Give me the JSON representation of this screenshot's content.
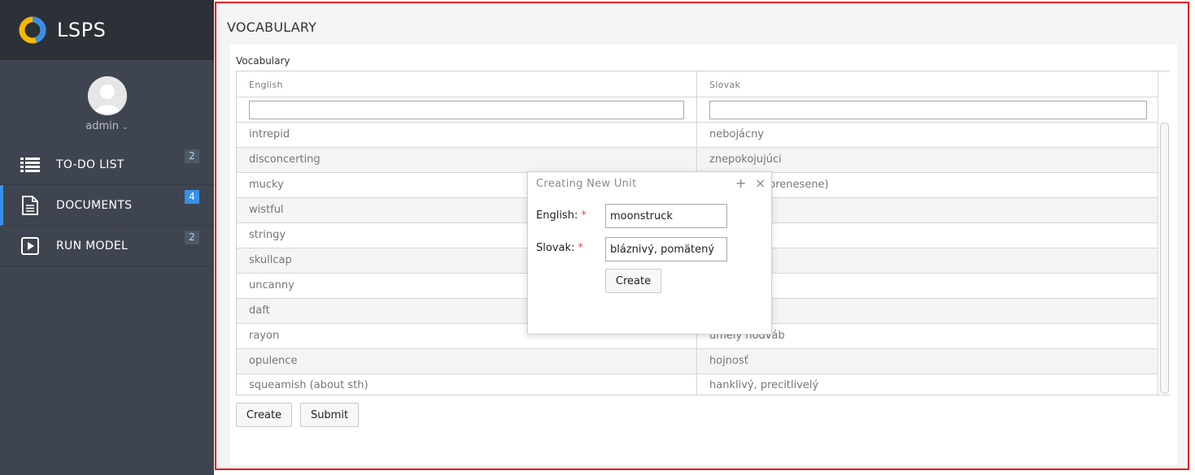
{
  "app": {
    "name": "LSPS"
  },
  "user": {
    "name": "admin"
  },
  "nav": [
    {
      "label": "TO-DO LIST",
      "icon": "list-icon",
      "badge": "2"
    },
    {
      "label": "DOCUMENTS",
      "icon": "document-icon",
      "badge": "4",
      "active": true
    },
    {
      "label": "RUN MODEL",
      "icon": "play-icon",
      "badge": "2"
    }
  ],
  "page": {
    "title": "VOCABULARY"
  },
  "panel": {
    "title": "Vocabulary"
  },
  "grid": {
    "columns": [
      "English",
      "Slovak"
    ],
    "filters": [
      "",
      ""
    ],
    "rows": [
      [
        "intrepid",
        "nebojácny"
      ],
      [
        "disconcerting",
        "znepokojujúci"
      ],
      [
        "mucky",
        "prenesene)"
      ],
      [
        "wistful",
        ""
      ],
      [
        "stringy",
        ""
      ],
      [
        "skullcap",
        ""
      ],
      [
        "uncanny",
        ""
      ],
      [
        "daft",
        ""
      ],
      [
        "rayon",
        "umelý hodváb"
      ],
      [
        "opulence",
        "hojnosť"
      ],
      [
        "squeamish (about sth)",
        "hanklivý, precitlivelý"
      ]
    ]
  },
  "actions": {
    "create": "Create",
    "submit": "Submit"
  },
  "modal": {
    "title": "Creating New Unit",
    "english_label": "English:",
    "slovak_label": "Slovak:",
    "required_mark": "*",
    "english_value": "moonstruck",
    "slovak_value": "bláznivý, pomätený",
    "create": "Create",
    "maximize_glyph": "+",
    "close_glyph": "×"
  },
  "colors": {
    "accent": "#3a8fe8",
    "frame": "#e2151c",
    "sidebar": "#3f4550",
    "brand_bar": "#2c3037"
  }
}
